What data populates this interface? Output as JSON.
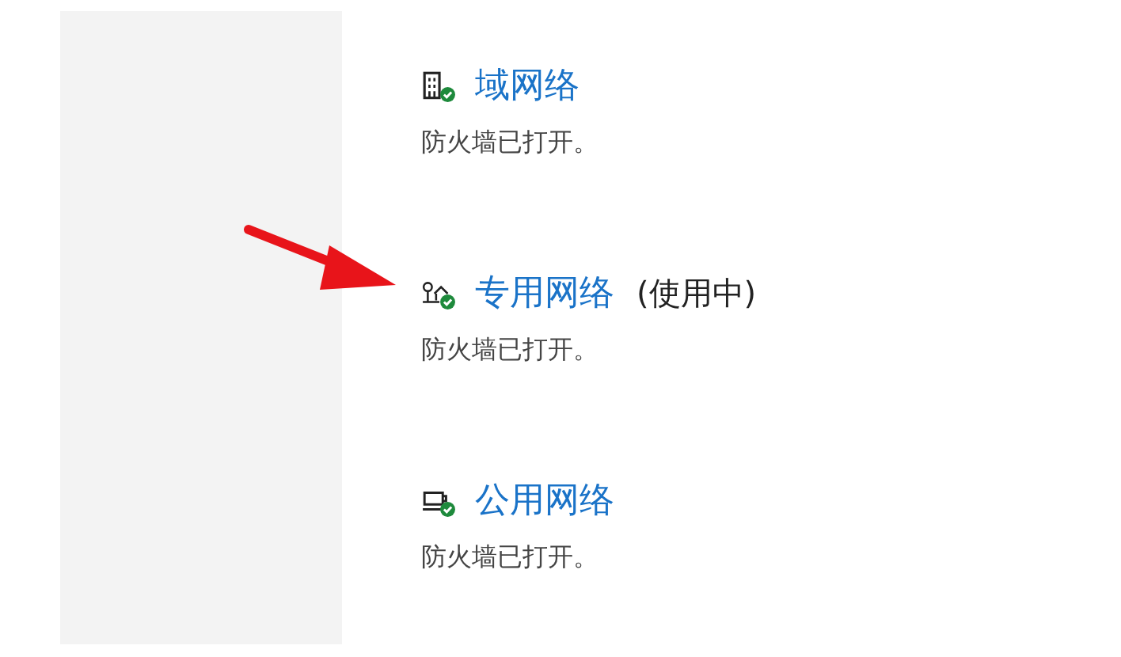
{
  "networks": [
    {
      "kind": "domain",
      "name": "域网络",
      "status": "防火墙已打开。"
    },
    {
      "kind": "private",
      "name": "专用网络",
      "note": "(使用中)",
      "status": "防火墙已打开。"
    },
    {
      "kind": "public",
      "name": "公用网络",
      "status": "防火墙已打开。"
    }
  ]
}
